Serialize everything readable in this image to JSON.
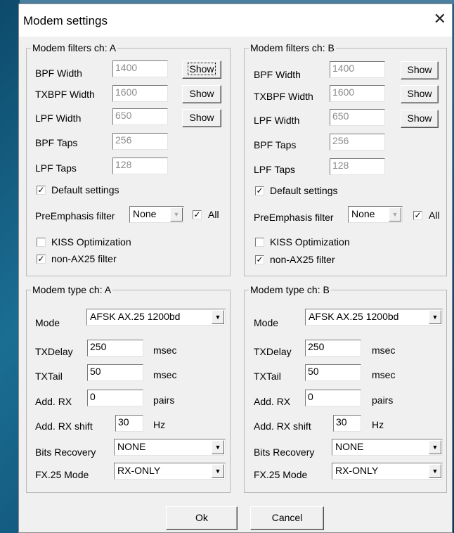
{
  "dialog": {
    "title": "Modem settings"
  },
  "channels": [
    {
      "filters": {
        "group_title": "Modem filters ch: A",
        "bpf_width": {
          "label": "BPF Width",
          "value": "1400",
          "button": "Show"
        },
        "txbpf_width": {
          "label": "TXBPF Width",
          "value": "1600",
          "button": "Show"
        },
        "lpf_width": {
          "label": "LPF Width",
          "value": "650",
          "button": "Show"
        },
        "bpf_taps": {
          "label": "BPF Taps",
          "value": "256"
        },
        "lpf_taps": {
          "label": "LPF Taps",
          "value": "128"
        },
        "default_settings": {
          "label": "Default settings",
          "checked": true
        },
        "preemphasis": {
          "label": "PreEmphasis filter",
          "value": "None",
          "all_label": "All",
          "all_checked": true
        },
        "kiss_optimization": {
          "label": "KISS Optimization",
          "checked": false
        },
        "non_ax25_filter": {
          "label": "non-AX25 filter",
          "checked": true
        }
      },
      "modem": {
        "group_title": "Modem type ch: A",
        "mode": {
          "label": "Mode",
          "value": "AFSK AX.25 1200bd"
        },
        "txdelay": {
          "label": "TXDelay",
          "value": "250",
          "unit": "msec"
        },
        "txtail": {
          "label": "TXTail",
          "value": "50",
          "unit": "msec"
        },
        "add_rx": {
          "label": "Add. RX",
          "value": "0",
          "unit": "pairs"
        },
        "add_rx_shift": {
          "label": "Add. RX shift",
          "value": "30",
          "unit": "Hz"
        },
        "bits_recovery": {
          "label": "Bits Recovery",
          "value": "NONE"
        },
        "fx25_mode": {
          "label": "FX.25 Mode",
          "value": "RX-ONLY"
        }
      }
    },
    {
      "filters": {
        "group_title": "Modem filters ch: B",
        "bpf_width": {
          "label": "BPF Width",
          "value": "1400",
          "button": "Show"
        },
        "txbpf_width": {
          "label": "TXBPF Width",
          "value": "1600",
          "button": "Show"
        },
        "lpf_width": {
          "label": "LPF Width",
          "value": "650",
          "button": "Show"
        },
        "bpf_taps": {
          "label": "BPF Taps",
          "value": "256"
        },
        "lpf_taps": {
          "label": "LPF Taps",
          "value": "128"
        },
        "default_settings": {
          "label": "Default settings",
          "checked": true
        },
        "preemphasis": {
          "label": "PreEmphasis filter",
          "value": "None",
          "all_label": "All",
          "all_checked": true
        },
        "kiss_optimization": {
          "label": "KISS Optimization",
          "checked": false
        },
        "non_ax25_filter": {
          "label": "non-AX25 filter",
          "checked": true
        }
      },
      "modem": {
        "group_title": "Modem type ch: B",
        "mode": {
          "label": "Mode",
          "value": "AFSK AX.25 1200bd"
        },
        "txdelay": {
          "label": "TXDelay",
          "value": "250",
          "unit": "msec"
        },
        "txtail": {
          "label": "TXTail",
          "value": "50",
          "unit": "msec"
        },
        "add_rx": {
          "label": "Add. RX",
          "value": "0",
          "unit": "pairs"
        },
        "add_rx_shift": {
          "label": "Add. RX shift",
          "value": "30",
          "unit": "Hz"
        },
        "bits_recovery": {
          "label": "Bits Recovery",
          "value": "NONE"
        },
        "fx25_mode": {
          "label": "FX.25 Mode",
          "value": "RX-ONLY"
        }
      }
    }
  ],
  "buttons": {
    "ok": "Ok",
    "cancel": "Cancel"
  },
  "icons": {
    "close": "close-icon",
    "dropdown": "chevron-down-icon",
    "check": "checkmark-icon"
  }
}
